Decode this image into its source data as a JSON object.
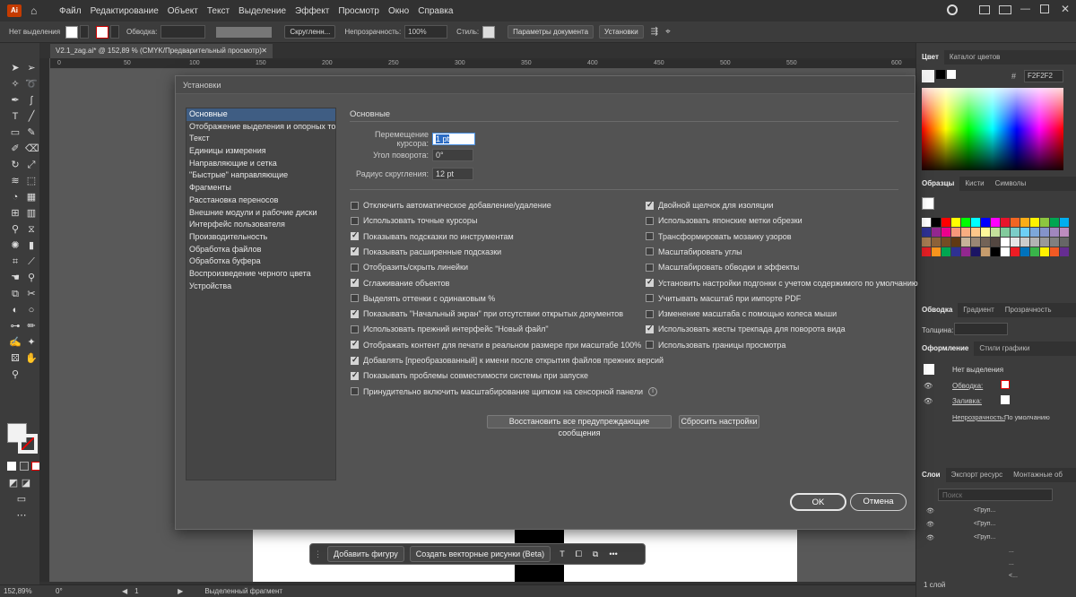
{
  "app": {
    "logo": "Ai"
  },
  "menu": [
    "Файл",
    "Редактирование",
    "Объект",
    "Текст",
    "Выделение",
    "Эффект",
    "Просмотр",
    "Окно",
    "Справка"
  ],
  "control_bar": {
    "selection": "Нет выделения",
    "stroke_label": "Обводка:",
    "corner_label": "Скругленн...",
    "opacity_label": "Непрозрачность:",
    "opacity_value": "100%",
    "style_label": "Стиль:",
    "doc_settings": "Параметры документа",
    "settings": "Установки"
  },
  "document": {
    "tab": "V2.1_zag.ai* @ 152,89 % (CMYK/Предварительный просмотр)",
    "ruler_ticks": [
      "0",
      "50",
      "100",
      "150",
      "200",
      "250",
      "300",
      "350",
      "400",
      "450",
      "500",
      "550",
      "600"
    ]
  },
  "status": {
    "zoom": "152,89%",
    "angle": "0°",
    "artboard": "1",
    "selection_text": "Выделенный фрагмент"
  },
  "taskbar": {
    "add_shape": "Добавить фигуру",
    "create_vector": "Создать векторные рисунки (Beta)"
  },
  "dialog": {
    "title": "Установки",
    "nav": [
      "Основные",
      "Отображение выделения и опорных точек",
      "Текст",
      "Единицы измерения",
      "Направляющие и сетка",
      "\"Быстрые\" направляющие",
      "Фрагменты",
      "Расстановка переносов",
      "Внешние модули и рабочие диски",
      "Интерфейс пользователя",
      "Производительность",
      "Обработка файлов",
      "Обработка буфера",
      "Воспроизведение черного цвета",
      "Устройства"
    ],
    "section": "Основные",
    "fields": {
      "cursor_label": "Перемещение курсора:",
      "cursor_value": "1 pt",
      "angle_label": "Угол поворота:",
      "angle_value": "0°",
      "radius_label": "Радиус скругления:",
      "radius_value": "12 pt"
    },
    "left_checks": [
      {
        "label": "Отключить автоматическое добавление/удаление",
        "checked": false
      },
      {
        "label": "Использовать точные курсоры",
        "checked": false
      },
      {
        "label": "Показывать подсказки по инструментам",
        "checked": true
      },
      {
        "label": "Показывать расширенные подсказки",
        "checked": true
      },
      {
        "label": "Отобразить/скрыть линейки",
        "checked": false
      },
      {
        "label": "Сглаживание объектов",
        "checked": true
      },
      {
        "label": "Выделять оттенки с одинаковым %",
        "checked": false
      },
      {
        "label": "Показывать \"Начальный экран\" при отсутствии открытых документов",
        "checked": true
      },
      {
        "label": "Использовать прежний интерфейс \"Новый файл\"",
        "checked": false
      },
      {
        "label": "Отображать контент для печати в реальном размере при масштабе 100%",
        "checked": true
      },
      {
        "label": "Добавлять [преобразованный] к имени после открытия файлов прежних версий",
        "checked": true
      },
      {
        "label": "Показывать проблемы совместимости системы при запуске",
        "checked": true
      },
      {
        "label": "Принудительно включить масштабирование щипком на сенсорной панели",
        "checked": false
      }
    ],
    "right_checks": [
      {
        "label": "Двойной щелчок для изоляции",
        "checked": true
      },
      {
        "label": "Использовать японские метки обрезки",
        "checked": false
      },
      {
        "label": "Трансформировать мозаику узоров",
        "checked": false
      },
      {
        "label": "Масштабировать углы",
        "checked": false
      },
      {
        "label": "Масштабировать обводки и эффекты",
        "checked": false
      },
      {
        "label": "Установить настройки подгонки с учетом содержимого по умолчанию",
        "checked": true
      },
      {
        "label": "Учитывать масштаб при импорте PDF",
        "checked": false
      },
      {
        "label": "Изменение масштаба с помощью колеса мыши",
        "checked": false
      },
      {
        "label": "Использовать жесты трекпада для поворота вида",
        "checked": true
      },
      {
        "label": "Использовать границы просмотра",
        "checked": false
      }
    ],
    "btn_reset_warnings": "Восстановить все предупреждающие сообщения",
    "btn_reset_prefs": "Сбросить настройки",
    "ok": "OK",
    "cancel": "Отмена"
  },
  "panels": {
    "color_tabs": [
      "Цвет",
      "Каталог цветов"
    ],
    "hex": "F2F2F2",
    "swatch_tabs": [
      "Образцы",
      "Кисти",
      "Символы"
    ],
    "stroke_tabs": [
      "Обводка",
      "Градиент",
      "Прозрачность"
    ],
    "thickness_label": "Толщина:",
    "appearance_tabs": [
      "Оформление",
      "Стили графики"
    ],
    "appearance": {
      "no_selection": "Нет выделения",
      "stroke": "Обводка:",
      "fill": "Заливка:",
      "opacity": "Непрозрачность:",
      "opacity_value": "По умолчанию"
    },
    "layers_tabs": [
      "Слои",
      "Экспорт ресурс",
      "Монтажные об"
    ],
    "search_placeholder": "Поиск",
    "layers": [
      "<Груп...",
      "<Груп...",
      "<Груп...",
      "...",
      "...",
      "<..."
    ],
    "layers_count": "1 слой"
  },
  "colors": {
    "swatches": [
      "#ffffff",
      "#000000",
      "#ff0000",
      "#ffff00",
      "#00ff00",
      "#00ffff",
      "#0000ff",
      "#ff00ff",
      "#e8132b",
      "#f26522",
      "#fbad17",
      "#fff200",
      "#8dc63f",
      "#00a651",
      "#00aeef",
      "#2e3192",
      "#92278f",
      "#ec008c",
      "#f7977a",
      "#f9ad81",
      "#fdc68a",
      "#fff79a",
      "#c4df9b",
      "#82ca9c",
      "#7bcdc8",
      "#6dcff6",
      "#7da7d9",
      "#8493ca",
      "#a187be",
      "#bd8cbf",
      "#a67c52",
      "#8c6239",
      "#754c24",
      "#603913",
      "#c7b299",
      "#998675",
      "#736357",
      "#534741",
      "#ffffff",
      "#e6e6e6",
      "#cccccc",
      "#b3b3b3",
      "#999999",
      "#808080",
      "#666666",
      "#e31e24",
      "#f7941d",
      "#00a651",
      "#2e3192",
      "#92278f",
      "#1b1464",
      "#c69c6d",
      "#000000",
      "#ffffff",
      "#ed1c24",
      "#0072bc",
      "#39b54a",
      "#fff200",
      "#f15a24",
      "#662d91"
    ]
  }
}
